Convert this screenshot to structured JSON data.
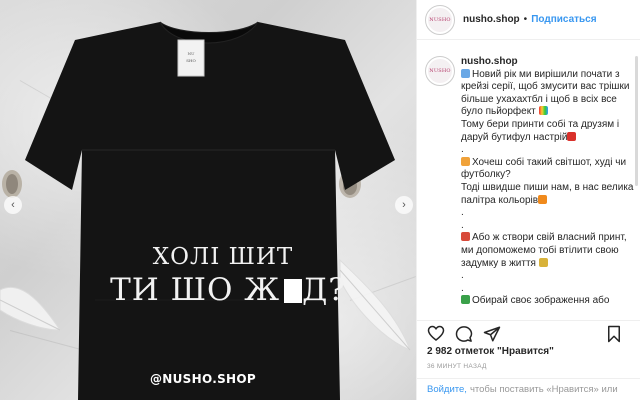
{
  "photo": {
    "print_line1": "ХОЛІ ШИТ",
    "print_line2_a": "ТИ ШО Ж",
    "print_line2_b": "Д?",
    "watermark": "@NUSHO.SHOP",
    "label_tag": "NUSHO",
    "prev_icon": "chevron-left-icon",
    "next_icon": "chevron-right-icon"
  },
  "header": {
    "username": "nusho.shop",
    "separator": "•",
    "follow_label": "Подписаться",
    "avatar_text": "NUSHO"
  },
  "caption": {
    "username": "nusho.shop",
    "lines": [
      "Новий рік ми вирішили почати з",
      "крейзі серії, щоб змусити вас трішки",
      "більше ухахахтбл і щоб в всіх все",
      "було пьйорфект",
      "Тому бери принти собі та друзям і",
      "даруй бутифул настрій",
      ".",
      "Хочеш собі такий світшот, худі чи",
      "футболку?",
      "Тоді швидше пиши нам, в нас велика",
      "палітра кольорів",
      ".",
      ".",
      "Або ж створи свій власний принт,",
      "ми допоможемо тобі втілити свою",
      "задумку в життя",
      ".",
      ".",
      "Обирай своє зображення або"
    ]
  },
  "actions": {
    "like_icon": "heart-icon",
    "comment_icon": "comment-icon",
    "share_icon": "share-icon",
    "save_icon": "bookmark-icon"
  },
  "likes": "2 982 отметок \"Нравится\"",
  "time": "36 МИНУТ НАЗАД",
  "comment_bar": {
    "login": "Войдите,",
    "rest": "чтобы поставить «Нравится» или"
  },
  "colors": {
    "link": "#3897f0",
    "text": "#262626",
    "muted": "#999999",
    "shirt": "#141414"
  }
}
